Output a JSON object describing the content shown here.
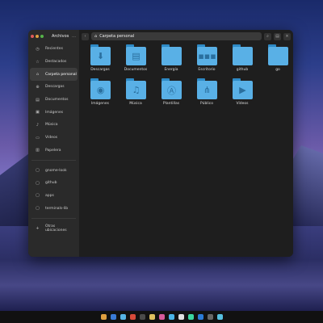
{
  "app": {
    "title": "Archivos",
    "menu": "…"
  },
  "toolbar": {
    "back": "‹",
    "forward": "›",
    "path": "Carpeta personal",
    "path_icon": "⌂",
    "menu": "⋮",
    "view": "▤"
  },
  "sidebar": {
    "items": [
      {
        "label": "Recientes",
        "icon": "clock-icon",
        "glyph": "◷"
      },
      {
        "label": "Destacados",
        "icon": "star-icon",
        "glyph": "☆"
      },
      {
        "label": "Carpeta personal",
        "icon": "home-icon",
        "glyph": "⌂"
      },
      {
        "label": "Descargas",
        "icon": "download-icon",
        "glyph": "⊕"
      },
      {
        "label": "Documentos",
        "icon": "document-icon",
        "glyph": "▤"
      },
      {
        "label": "Imágenes",
        "icon": "image-icon",
        "glyph": "▣"
      },
      {
        "label": "Música",
        "icon": "music-icon",
        "glyph": "♪"
      },
      {
        "label": "Vídeos",
        "icon": "video-icon",
        "glyph": "▭"
      },
      {
        "label": "Papelera",
        "icon": "trash-icon",
        "glyph": "▥"
      }
    ],
    "bookmarks": [
      {
        "label": "gnome-look",
        "icon": "folder-icon",
        "glyph": "▢"
      },
      {
        "label": "github",
        "icon": "folder-icon",
        "glyph": "▢"
      },
      {
        "label": "apps",
        "icon": "folder-icon",
        "glyph": "▢"
      },
      {
        "label": "terminals-lib",
        "icon": "folder-icon",
        "glyph": "▢"
      }
    ],
    "other": {
      "label": "Otras ubicaciones",
      "icon": "plus-icon",
      "glyph": "+"
    }
  },
  "folders": [
    {
      "label": "Descargas",
      "glyph": "⬇"
    },
    {
      "label": "Documentos",
      "glyph": "▤"
    },
    {
      "label": "Energía",
      "glyph": ""
    },
    {
      "label": "Escritorio",
      "glyph": "▪▪▪"
    },
    {
      "label": "github",
      "glyph": ""
    },
    {
      "label": "go",
      "glyph": ""
    },
    {
      "label": "Imágenes",
      "glyph": "◉"
    },
    {
      "label": "Música",
      "glyph": "♫"
    },
    {
      "label": "Plantillas",
      "glyph": "Ⓐ"
    },
    {
      "label": "Público",
      "glyph": "⋔"
    },
    {
      "label": "Vídeos",
      "glyph": "▶"
    }
  ],
  "colors": {
    "accent": "#59b0e6",
    "folder_tab": "#2e8ac6",
    "close": "#e05a5a",
    "min": "#e0a040",
    "max": "#56b44a"
  },
  "taskbar_colors": [
    "#e0a040",
    "#3a7ad6",
    "#56b4e6",
    "#d64a3a",
    "#4a4a4a",
    "#e0c060",
    "#d65a9a",
    "#4ab4e6",
    "#e0e0e0",
    "#3ad6a0",
    "#2a7ad6",
    "#666",
    "#56c0e0"
  ]
}
